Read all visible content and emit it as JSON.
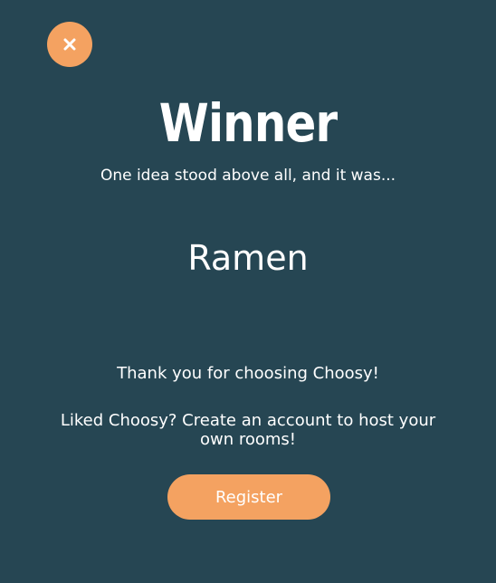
{
  "header": {
    "close_icon": "close-icon"
  },
  "result": {
    "title": "Winner",
    "subtitle": "One idea stood above all, and it was...",
    "winning_idea": "Ramen"
  },
  "footer": {
    "thanks": "Thank you for choosing Choosy!",
    "promo": "Liked Choosy? Create an account to host your own rooms!",
    "register_label": "Register"
  },
  "colors": {
    "background": "#264653",
    "accent": "#f4a261",
    "text": "#ffffff"
  }
}
